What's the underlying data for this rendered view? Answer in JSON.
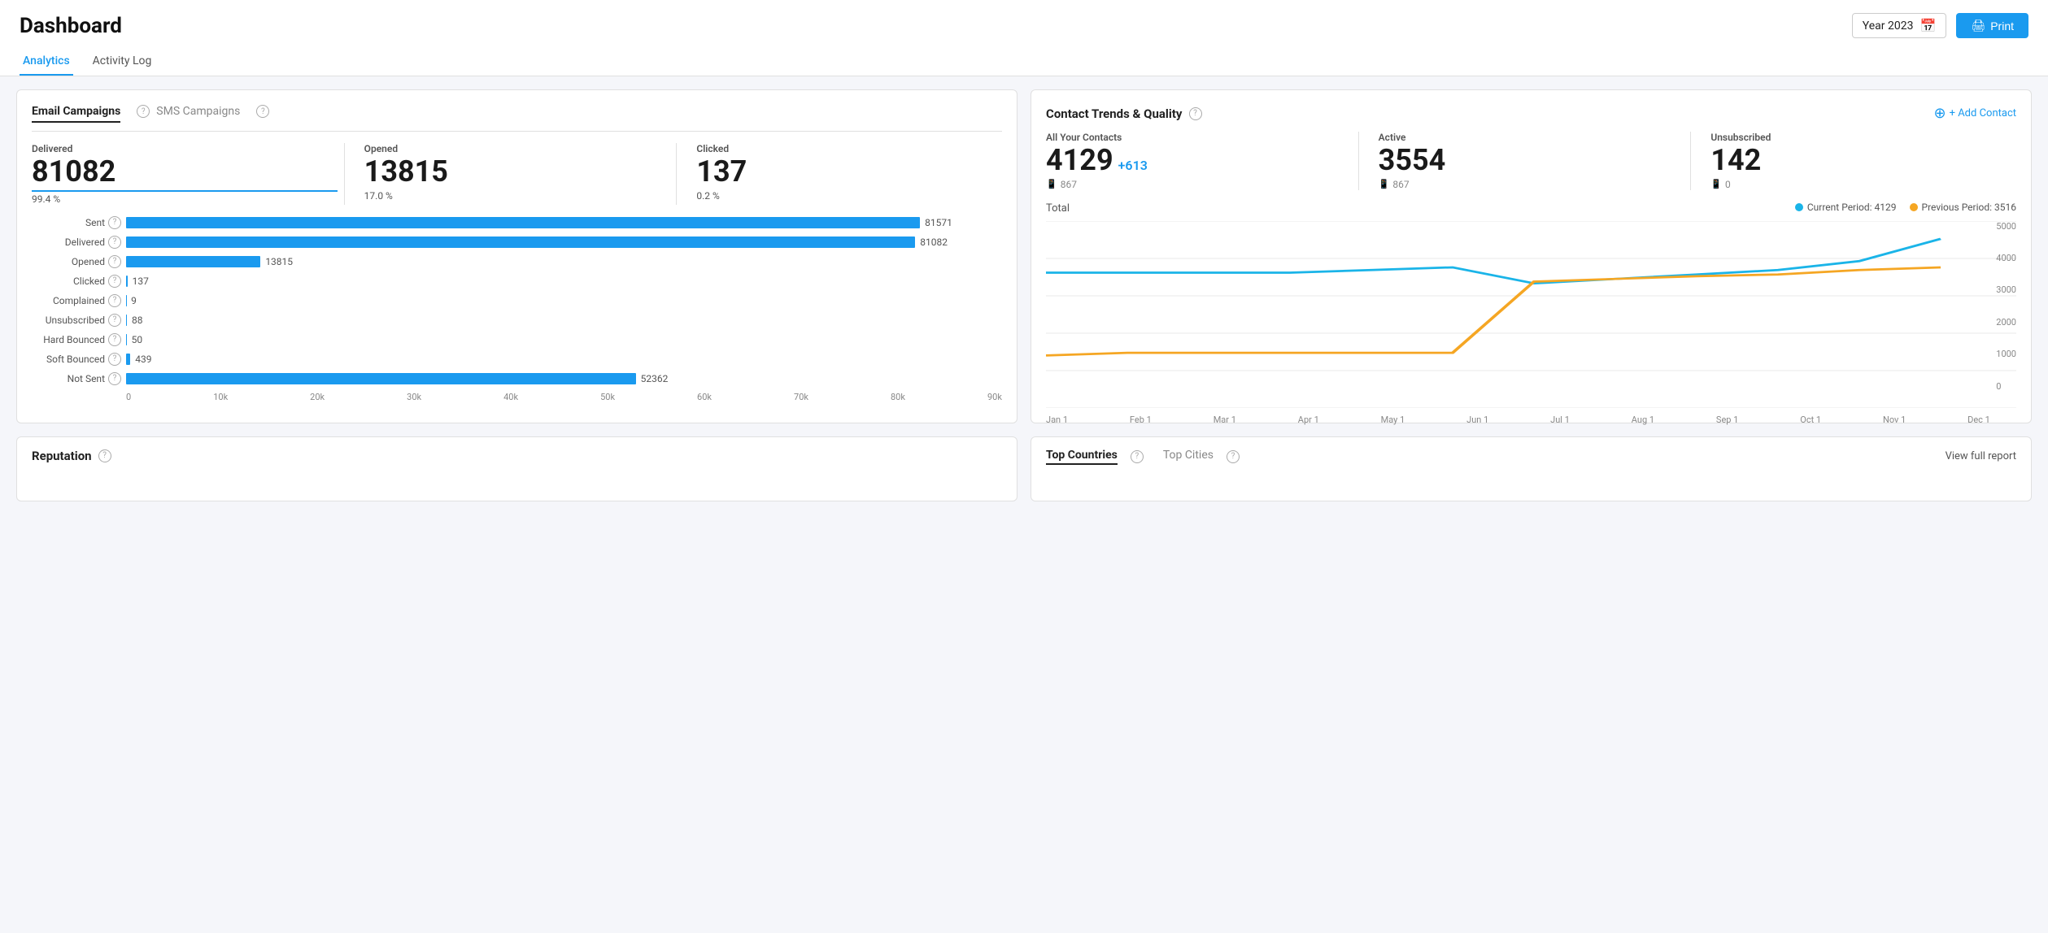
{
  "page": {
    "title": "Dashboard",
    "year_selector": "Year 2023",
    "print_label": "Print"
  },
  "tabs": [
    {
      "id": "analytics",
      "label": "Analytics",
      "active": true
    },
    {
      "id": "activity_log",
      "label": "Activity Log",
      "active": false
    }
  ],
  "email_campaigns": {
    "title": "Email Campaigns",
    "sms_title": "SMS Campaigns",
    "stats": {
      "delivered": {
        "label": "Delivered",
        "value": "81082",
        "pct": "99.4 %"
      },
      "opened": {
        "label": "Opened",
        "value": "13815",
        "pct": "17.0 %"
      },
      "clicked": {
        "label": "Clicked",
        "value": "137",
        "pct": "0.2 %"
      }
    },
    "bars": [
      {
        "label": "Sent",
        "value": 81571,
        "display": "81571",
        "max": 90000
      },
      {
        "label": "Delivered",
        "value": 81082,
        "display": "81082",
        "max": 90000
      },
      {
        "label": "Opened",
        "value": 13815,
        "display": "13815",
        "max": 90000
      },
      {
        "label": "Clicked",
        "value": 137,
        "display": "137",
        "max": 90000
      },
      {
        "label": "Complained",
        "value": 9,
        "display": "9",
        "max": 90000
      },
      {
        "label": "Unsubscribed",
        "value": 88,
        "display": "88",
        "max": 90000
      },
      {
        "label": "Hard Bounced",
        "value": 50,
        "display": "50",
        "max": 90000
      },
      {
        "label": "Soft Bounced",
        "value": 439,
        "display": "439",
        "max": 90000
      },
      {
        "label": "Not Sent",
        "value": 52362,
        "display": "52362",
        "max": 90000
      }
    ],
    "x_axis": [
      "0",
      "10k",
      "20k",
      "30k",
      "40k",
      "50k",
      "60k",
      "70k",
      "80k",
      "90k"
    ]
  },
  "contact_trends": {
    "title": "Contact Trends & Quality",
    "add_contact_label": "+ Add Contact",
    "stats": {
      "all_contacts": {
        "label": "All Your Contacts",
        "value": "4129",
        "plus": "+613",
        "phone": "867"
      },
      "active": {
        "label": "Active",
        "value": "3554",
        "phone": "867"
      },
      "unsubscribed": {
        "label": "Unsubscribed",
        "value": "142",
        "phone": "0"
      }
    },
    "total_label": "Total",
    "legend": [
      {
        "label": "Current Period: 4129",
        "color": "#1ab4e8"
      },
      {
        "label": "Previous Period: 3516",
        "color": "#f5a623"
      }
    ],
    "chart": {
      "y_labels": [
        "5000",
        "4000",
        "3000",
        "2000",
        "1000",
        "0"
      ],
      "x_labels": [
        "Jan 1",
        "Feb 1",
        "Mar 1",
        "Apr 1",
        "May 1",
        "Jun 1",
        "Jul 1",
        "Aug 1",
        "Sep 1",
        "Oct 1",
        "Nov 1",
        "Dec 1"
      ]
    }
  },
  "reputation": {
    "title": "Reputation"
  },
  "top_locations": {
    "title": "Top Countries",
    "tab2": "Top Cities",
    "view_report": "View full report"
  }
}
